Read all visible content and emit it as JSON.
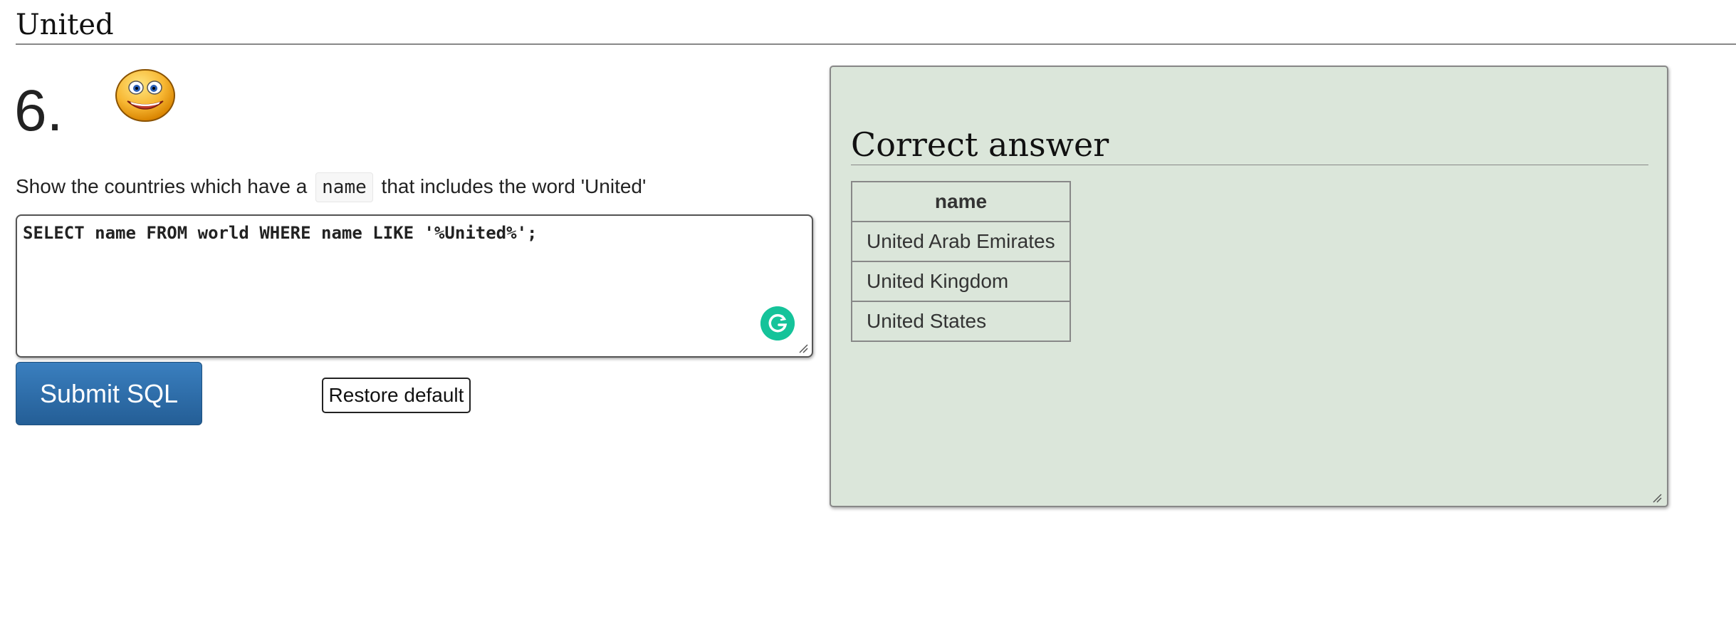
{
  "section": {
    "title": "United"
  },
  "question": {
    "number": "6.",
    "smiley_icon": "grinning-face-icon",
    "prompt_before": "Show the countries which have a",
    "prompt_code": "name",
    "prompt_after": "that includes the word 'United'"
  },
  "editor": {
    "value": "SELECT name FROM world WHERE name LIKE '%United%';",
    "assistant_icon": "grammarly-icon"
  },
  "buttons": {
    "submit_label": "Submit SQL",
    "restore_label": "Restore default"
  },
  "answer": {
    "title": "Correct answer",
    "columns": [
      "name"
    ],
    "rows": [
      [
        "United Arab Emirates"
      ],
      [
        "United Kingdom"
      ],
      [
        "United States"
      ]
    ]
  },
  "colors": {
    "panel_background": "#dbe6da",
    "submit_button": "#2d6da8",
    "grammarly": "#15c39a"
  }
}
